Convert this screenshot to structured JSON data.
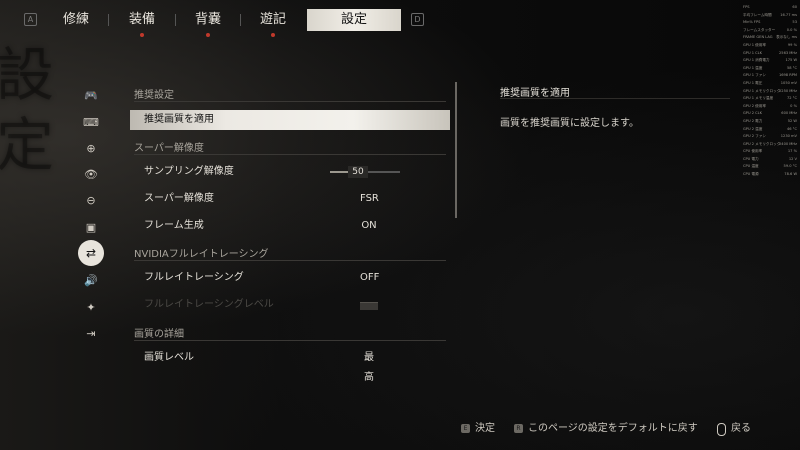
{
  "background": {
    "calligraphy": "設定"
  },
  "topnav": {
    "left_key": "A",
    "right_key": "D",
    "tabs": [
      {
        "label": "修練",
        "dot": false,
        "active": false
      },
      {
        "label": "装備",
        "dot": true,
        "active": false
      },
      {
        "label": "背嚢",
        "dot": true,
        "active": false
      },
      {
        "label": "遊記",
        "dot": true,
        "active": false
      },
      {
        "label": "設定",
        "dot": false,
        "active": true
      }
    ]
  },
  "sidebar": {
    "icons": [
      {
        "name": "gamepad-icon",
        "glyph": "🎮"
      },
      {
        "name": "keyboard-icon",
        "glyph": "⌨"
      },
      {
        "name": "crosshair-icon",
        "glyph": "⊕"
      },
      {
        "name": "eye-icon",
        "glyph": "👁"
      },
      {
        "name": "zoom-icon",
        "glyph": "⊖"
      },
      {
        "name": "display-icon",
        "glyph": "▣"
      },
      {
        "name": "graphics-icon",
        "glyph": "⇄",
        "active": true
      },
      {
        "name": "audio-icon",
        "glyph": "🔊"
      },
      {
        "name": "accessibility-icon",
        "glyph": "✦"
      },
      {
        "name": "exit-icon",
        "glyph": "⇥"
      }
    ]
  },
  "settings": {
    "sections": [
      {
        "title": "推奨設定"
      },
      {
        "title": "スーパー解像度"
      },
      {
        "title": "NVIDIAフルレイトレーシング"
      },
      {
        "title": "画質の詳細"
      }
    ],
    "rows": {
      "recommended": {
        "label": "推奨画質を適用"
      },
      "sampling": {
        "label": "サンプリング解像度",
        "value": "50",
        "level": 0.5
      },
      "super_res": {
        "label": "スーパー解像度",
        "value": "FSR"
      },
      "frame_gen": {
        "label": "フレーム生成",
        "value": "ON"
      },
      "full_rt": {
        "label": "フルレイトレーシング",
        "value": "OFF"
      },
      "full_rt_level": {
        "label": "フルレイトレーシングレベル"
      },
      "quality_level": {
        "label": "画質レベル",
        "value": "最高"
      }
    }
  },
  "description": {
    "title": "推奨画質を適用",
    "text": "画質を推奨画質に設定します。"
  },
  "perf_overlay": {
    "rows": [
      {
        "k": "FPS",
        "v": "60"
      },
      {
        "k": "平均フレーム時間",
        "v": "16.77 ms"
      },
      {
        "k": "Min% FPS",
        "v": "53"
      },
      {
        "k": "フレームスタッター",
        "v": "0.0 %"
      },
      {
        "k": "FRAME GEN LAG",
        "v": "表示なし ms"
      },
      {
        "k": "GPU 1 使用率",
        "v": "99 %"
      },
      {
        "k": "GPU 1 CLK",
        "v": "2563 MHz"
      },
      {
        "k": "GPU 1 消費電力",
        "v": "175 W"
      },
      {
        "k": "GPU 1 温度",
        "v": "58 °C"
      },
      {
        "k": "GPU 1 ファン",
        "v": "1698 RPM"
      },
      {
        "k": "GPU 1 電圧",
        "v": "1050 mV"
      },
      {
        "k": "GPU 1 メモリクロック",
        "v": "2250 MHz"
      },
      {
        "k": "GPU 1 メモリ温度",
        "v": "72 °C"
      },
      {
        "k": "GPU 2 使用率",
        "v": "0 %"
      },
      {
        "k": "GPU 2 CLK",
        "v": "600 MHz"
      },
      {
        "k": "GPU 2 電力",
        "v": "52 W"
      },
      {
        "k": "GPU 2 温度",
        "v": "46 °C"
      },
      {
        "k": "GPU 2 ファン",
        "v": "1230 mV"
      },
      {
        "k": "GPU 2 メモリクロック",
        "v": "2400 MHz"
      },
      {
        "k": "CPU 使用率",
        "v": "17 %"
      },
      {
        "k": "CPU 電力",
        "v": "12 V"
      },
      {
        "k": "CPU 温度",
        "v": "59.0 °C"
      },
      {
        "k": "CPU 電源",
        "v": "78.6 W"
      }
    ]
  },
  "footer": {
    "confirm_key": "E",
    "confirm_label": "決定",
    "reset_key": "R",
    "reset_label": "このページの設定をデフォルトに戻す",
    "back_label": "戻る"
  }
}
